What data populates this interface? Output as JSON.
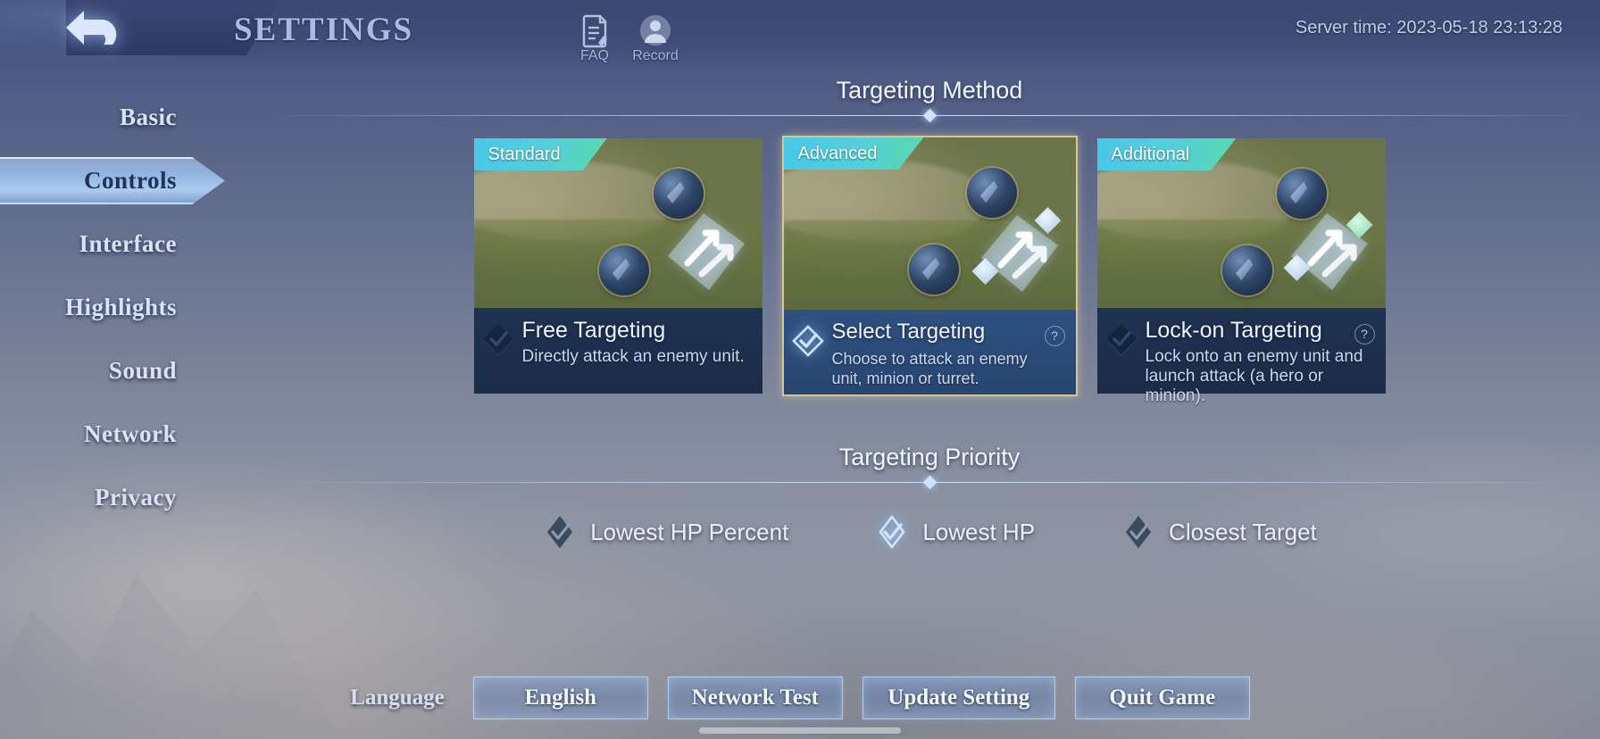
{
  "header": {
    "back_icon": "back-arrow-icon",
    "title": "SETTINGS",
    "faq": {
      "icon": "faq-document-icon",
      "label": "FAQ"
    },
    "record": {
      "icon": "record-person-icon",
      "label": "Record"
    },
    "server_time": "Server time: 2023-05-18 23:13:28"
  },
  "sidebar": {
    "items": [
      {
        "label": "Basic",
        "selected": false
      },
      {
        "label": "Controls",
        "selected": true
      },
      {
        "label": "Interface",
        "selected": false
      },
      {
        "label": "Highlights",
        "selected": false
      },
      {
        "label": "Sound",
        "selected": false
      },
      {
        "label": "Network",
        "selected": false
      },
      {
        "label": "Privacy",
        "selected": false
      }
    ]
  },
  "targeting_method": {
    "section_title": "Targeting Method",
    "cards": [
      {
        "tag": "Standard",
        "title": "Free Targeting",
        "description": "Directly attack an enemy unit.",
        "selected": false,
        "has_help": false
      },
      {
        "tag": "Advanced",
        "title": "Select Targeting",
        "description": "Choose to attack an enemy unit, minion or turret.",
        "selected": true,
        "has_help": true,
        "help_label": "?"
      },
      {
        "tag": "Additional",
        "title": "Lock-on Targeting",
        "description": "Lock onto an enemy unit and launch attack (a hero or minion).",
        "selected": false,
        "has_help": true,
        "help_label": "?"
      }
    ]
  },
  "targeting_priority": {
    "section_title": "Targeting Priority",
    "options": [
      {
        "label": "Lowest HP Percent",
        "selected": false
      },
      {
        "label": "Lowest HP",
        "selected": true
      },
      {
        "label": "Closest Target",
        "selected": false
      }
    ]
  },
  "bottom_bar": {
    "language_label": "Language",
    "buttons": [
      {
        "label": "English"
      },
      {
        "label": "Network Test"
      },
      {
        "label": "Update Setting"
      },
      {
        "label": "Quit Game"
      }
    ]
  },
  "colors": {
    "accent_gold": "#d8c49a",
    "tag_gradient_start": "#49c8e8",
    "tag_gradient_end": "#57d9ae",
    "card_panel": "#1e3251",
    "card_panel_selected": "#2e5181",
    "highlight_blue": "#cfe4ff"
  }
}
